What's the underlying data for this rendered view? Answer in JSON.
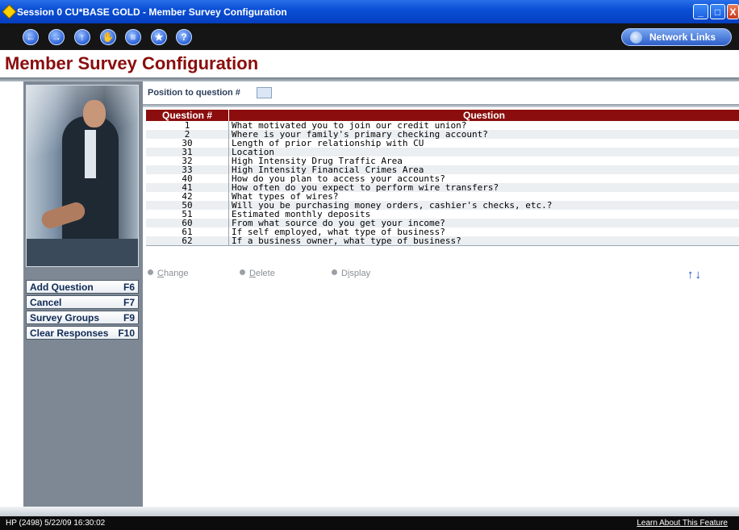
{
  "window": {
    "title": "Session 0 CU*BASE GOLD - Member Survey Configuration",
    "controls": {
      "minimize": "_",
      "maximize": "□",
      "close": "X"
    }
  },
  "toolbar": {
    "nav_buttons": [
      {
        "name": "back",
        "glyph": "←"
      },
      {
        "name": "forward",
        "glyph": "→"
      },
      {
        "name": "up",
        "glyph": "↑"
      },
      {
        "name": "stop",
        "glyph": "✋"
      },
      {
        "name": "print",
        "glyph": "≡"
      },
      {
        "name": "favorites",
        "glyph": "★"
      },
      {
        "name": "help",
        "glyph": "?"
      }
    ],
    "network_links_label": "Network Links"
  },
  "page": {
    "title": "Member Survey Configuration",
    "position_label": "Position to question #",
    "position_value": ""
  },
  "actions": [
    {
      "label": "Add Question",
      "key": "F6"
    },
    {
      "label": "Cancel",
      "key": "F7"
    },
    {
      "label": "Survey Groups",
      "key": "F9"
    },
    {
      "label": "Clear Responses",
      "key": "F10"
    }
  ],
  "table": {
    "headers": [
      "Question #",
      "Question"
    ],
    "rows": [
      {
        "num": "1",
        "question": "What motivated you to join our credit union?"
      },
      {
        "num": "2",
        "question": "Where is your family's primary checking account?"
      },
      {
        "num": "30",
        "question": "Length of prior relationship with CU"
      },
      {
        "num": "31",
        "question": "Location"
      },
      {
        "num": "32",
        "question": "High Intensity Drug Traffic Area"
      },
      {
        "num": "33",
        "question": "High Intensity Financial Crimes Area"
      },
      {
        "num": "40",
        "question": "How do you plan to access your accounts?"
      },
      {
        "num": "41",
        "question": "How often do you expect to perform wire transfers?"
      },
      {
        "num": "42",
        "question": "What types of wires?"
      },
      {
        "num": "50",
        "question": "Will you be purchasing money orders, cashier's checks, etc.?"
      },
      {
        "num": "51",
        "question": "Estimated monthly deposits"
      },
      {
        "num": "60",
        "question": "From what source do you get your income?"
      },
      {
        "num": "61",
        "question": "If self employed, what type of business?"
      },
      {
        "num": "62",
        "question": "If a business owner, what type of business?"
      }
    ]
  },
  "row_options": [
    {
      "first": "C",
      "rest": "hange"
    },
    {
      "first": "D",
      "rest": "elete"
    },
    {
      "first": "D",
      "rest": "isplay",
      "underline_index": 1
    }
  ],
  "scroll_arrows": "↑↓",
  "status": {
    "left": "HP (2498) 5/22/09 16:30:02",
    "right": "Learn About This Feature"
  },
  "colors": {
    "title_accent": "#8b0d0d",
    "header_bg": "#8b0d0d",
    "titlebar_blue": "#0a4fd6",
    "panel_gray": "#7e8894"
  }
}
